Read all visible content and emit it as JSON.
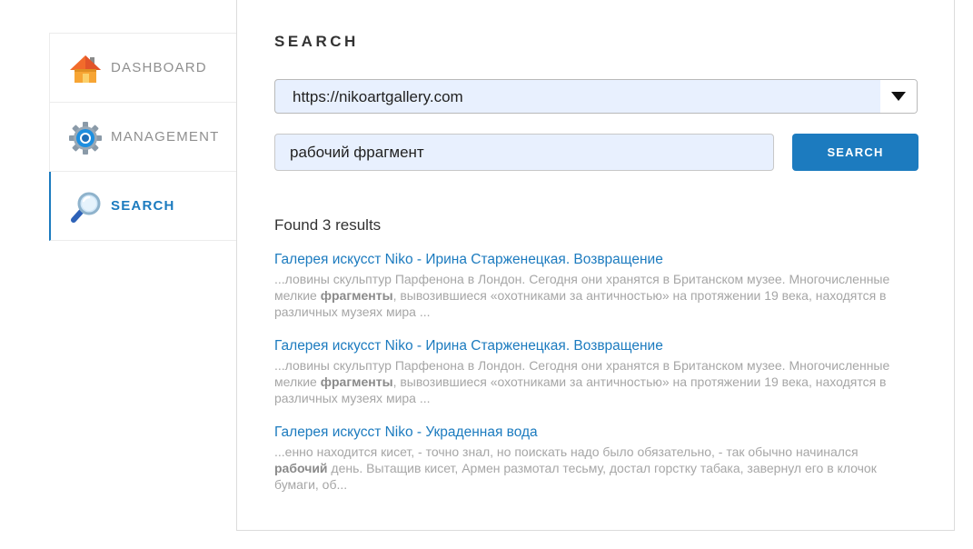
{
  "sidebar": {
    "items": [
      {
        "label": "DASHBOARD",
        "icon": "home-icon",
        "active": false
      },
      {
        "label": "MANAGEMENT",
        "icon": "gear-icon",
        "active": false
      },
      {
        "label": "SEARCH",
        "icon": "magnifier-icon",
        "active": true
      }
    ]
  },
  "main": {
    "title": "SEARCH",
    "site_select": {
      "value": "https://nikoartgallery.com"
    },
    "query": {
      "value": "рабочий фрагмент"
    },
    "search_button_label": "SEARCH",
    "found_text": "Found 3 results",
    "results": [
      {
        "title": "Галерея искусст Niko - Ирина Старженецкая. Возвращение",
        "snippet": [
          {
            "text": "...ловины скульптур Парфенона в Лондон. Сегодня они хранятся в Британском музее. Многочисленные мелкие ",
            "bold": false
          },
          {
            "text": "фрагменты",
            "bold": true
          },
          {
            "text": ", вывозившиеся «охотниками за античностью» на протяжении 19 века, находятся в различных музеях мира ...",
            "bold": false
          }
        ]
      },
      {
        "title": "Галерея искусст Niko - Ирина Старженецкая. Возвращение",
        "snippet": [
          {
            "text": "...ловины скульптур Парфенона в Лондон. Сегодня они хранятся в Британском музее. Многочисленные мелкие ",
            "bold": false
          },
          {
            "text": "фрагменты",
            "bold": true
          },
          {
            "text": ", вывозившиеся «охотниками за античностью» на протяжении 19 века, находятся в различных музеях мира ...",
            "bold": false
          }
        ]
      },
      {
        "title": "Галерея искусст Niko - Украденная вода",
        "snippet": [
          {
            "text": "...енно находится кисет, - точно знал, но поискать  надо было обязательно, - так обычно начинался ",
            "bold": false
          },
          {
            "text": "рабочий",
            "bold": true
          },
          {
            "text": " день. Вытащив кисет, Армен размотал тесьму, достал горстку табака, завернул его в клочок бумаги, об...",
            "bold": false
          }
        ]
      }
    ]
  },
  "colors": {
    "accent": "#1c7bbf",
    "input_bg": "#e8f0fe",
    "snippet_text": "#a6a6a6"
  }
}
